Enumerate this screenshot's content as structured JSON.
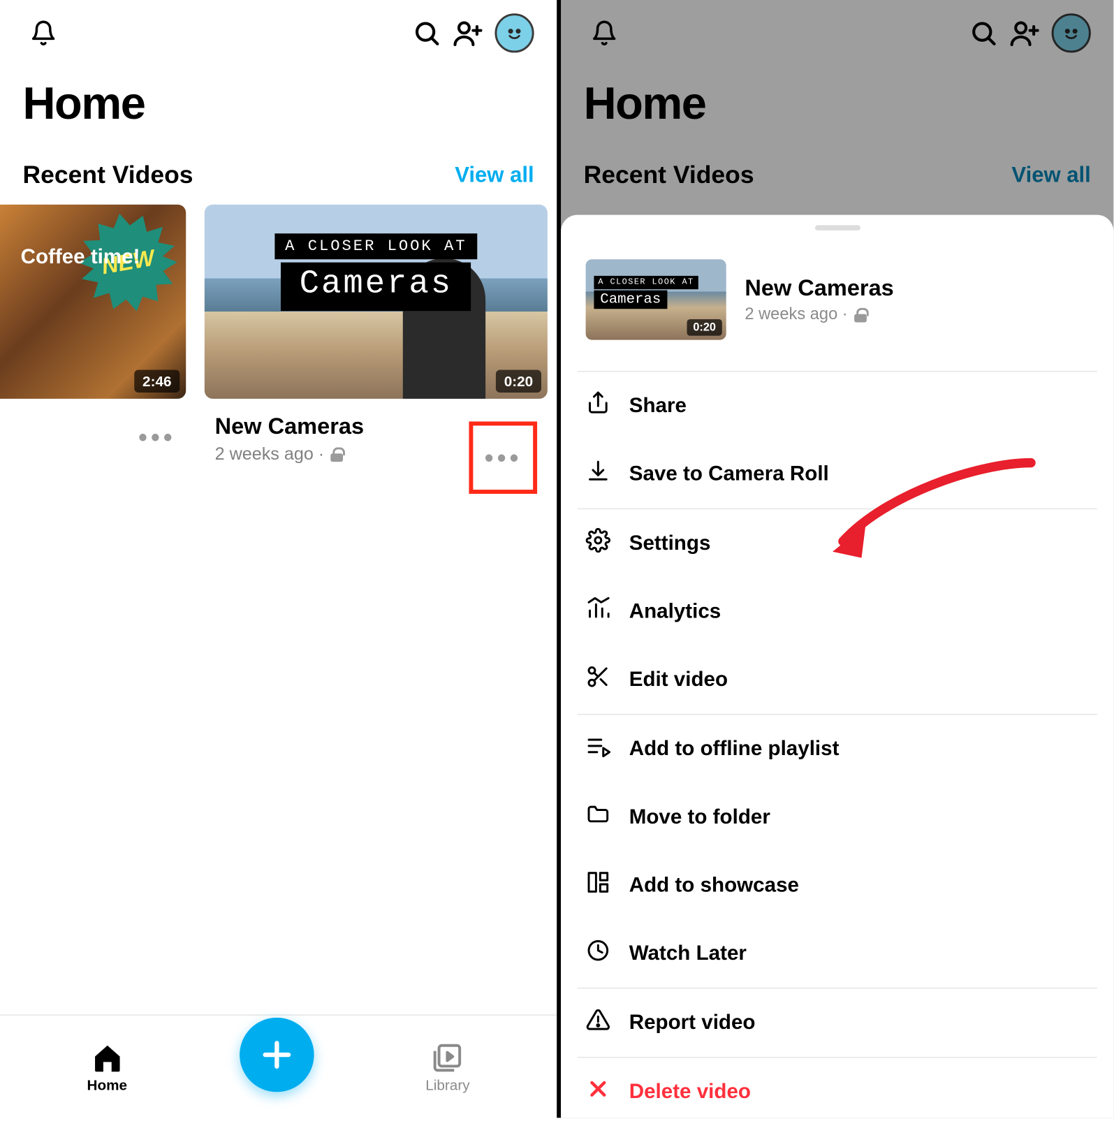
{
  "header": {
    "page_title": "Home"
  },
  "section": {
    "heading": "Recent Videos",
    "view_all": "View all"
  },
  "cards": [
    {
      "badge": "NEW",
      "overlay_title": "Coffee time!",
      "duration": "2:46",
      "title": "!",
      "subtitle": ""
    },
    {
      "line1": "A CLOSER LOOK AT",
      "line2": "Cameras",
      "duration": "0:20",
      "title": "New Cameras",
      "subtitle": "2 weeks ago ·"
    }
  ],
  "nav": {
    "home": "Home",
    "library": "Library"
  },
  "sheet": {
    "mini": {
      "line1": "A CLOSER LOOK AT",
      "line2": "Cameras",
      "duration": "0:20"
    },
    "title": "New Cameras",
    "subtitle": "2 weeks ago ·",
    "items": [
      {
        "label": "Share",
        "icon": "share"
      },
      {
        "label": "Save to Camera Roll",
        "icon": "download"
      },
      {
        "label": "Settings",
        "icon": "gear"
      },
      {
        "label": "Analytics",
        "icon": "chart"
      },
      {
        "label": "Edit video",
        "icon": "scissors"
      },
      {
        "label": "Add to offline playlist",
        "icon": "playlist"
      },
      {
        "label": "Move to folder",
        "icon": "folder"
      },
      {
        "label": "Add to showcase",
        "icon": "showcase"
      },
      {
        "label": "Watch Later",
        "icon": "clock"
      },
      {
        "label": "Report video",
        "icon": "warn"
      },
      {
        "label": "Delete video",
        "icon": "x",
        "danger": true
      }
    ]
  }
}
